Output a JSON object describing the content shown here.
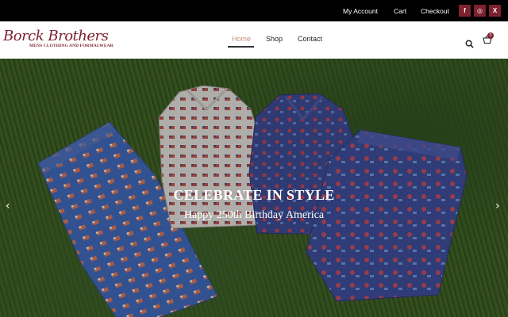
{
  "topbar": {
    "links": [
      "My Account",
      "Cart",
      "Checkout"
    ],
    "social": [
      {
        "icon": "facebook-icon",
        "glyph": "f"
      },
      {
        "icon": "instagram-icon",
        "glyph": "◎"
      },
      {
        "icon": "x-icon",
        "glyph": "X"
      }
    ]
  },
  "logo": {
    "name": "Borck Brothers",
    "tagline": "MENS CLOTHING AND FORMALWEAR"
  },
  "nav": {
    "items": [
      "Home",
      "Shop",
      "Contact"
    ],
    "active": "Home"
  },
  "cart": {
    "count": "0"
  },
  "hero": {
    "headline": "CELEBRATE IN STYLE",
    "subline": "Happy 250th Birthday America",
    "prev_arrow": "‹",
    "next_arrow": "›"
  },
  "colors": {
    "brand": "#7e2131",
    "active_nav": "#c9907a",
    "topbar_bg": "#000000"
  }
}
